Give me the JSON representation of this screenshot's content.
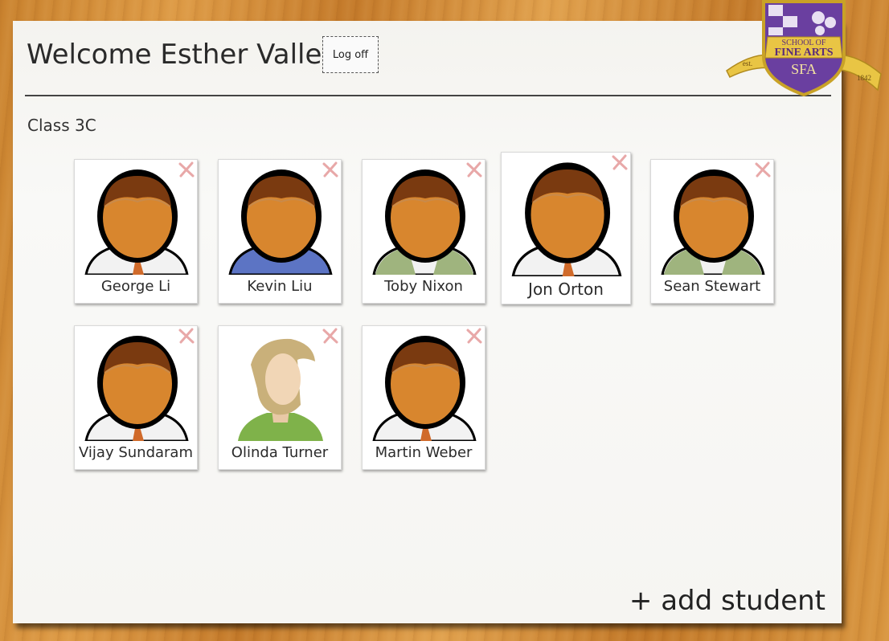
{
  "header": {
    "title": "Welcome Esther Valle!",
    "logoff_label": "Log off"
  },
  "logo": {
    "line1": "SCHOOL OF",
    "line2": "FINE ARTS",
    "initials": "SFA",
    "est": "est.",
    "year": "1842"
  },
  "class_name": "Class 3C",
  "students": [
    {
      "name": "George Li",
      "avatar": "male-tie-avatar"
    },
    {
      "name": "Kevin Liu",
      "avatar": "male-sweater-avatar"
    },
    {
      "name": "Toby Nixon",
      "avatar": "male-vest-avatar"
    },
    {
      "name": "Jon Orton",
      "avatar": "male-tie-avatar"
    },
    {
      "name": "Sean Stewart",
      "avatar": "male-vest-avatar"
    },
    {
      "name": "Vijay Sundaram",
      "avatar": "male-tie-avatar"
    },
    {
      "name": "Olinda Turner",
      "avatar": "female-avatar"
    },
    {
      "name": "Martin Weber",
      "avatar": "male-tie-avatar"
    }
  ],
  "actions": {
    "add_student_label": "+ add student"
  },
  "icons": {
    "remove": "close-x-icon"
  },
  "colors": {
    "remove_x": "#e8a8a8",
    "skin": "#d8862e",
    "hair": "#7a3a10",
    "paper": "#f6f5f2"
  }
}
